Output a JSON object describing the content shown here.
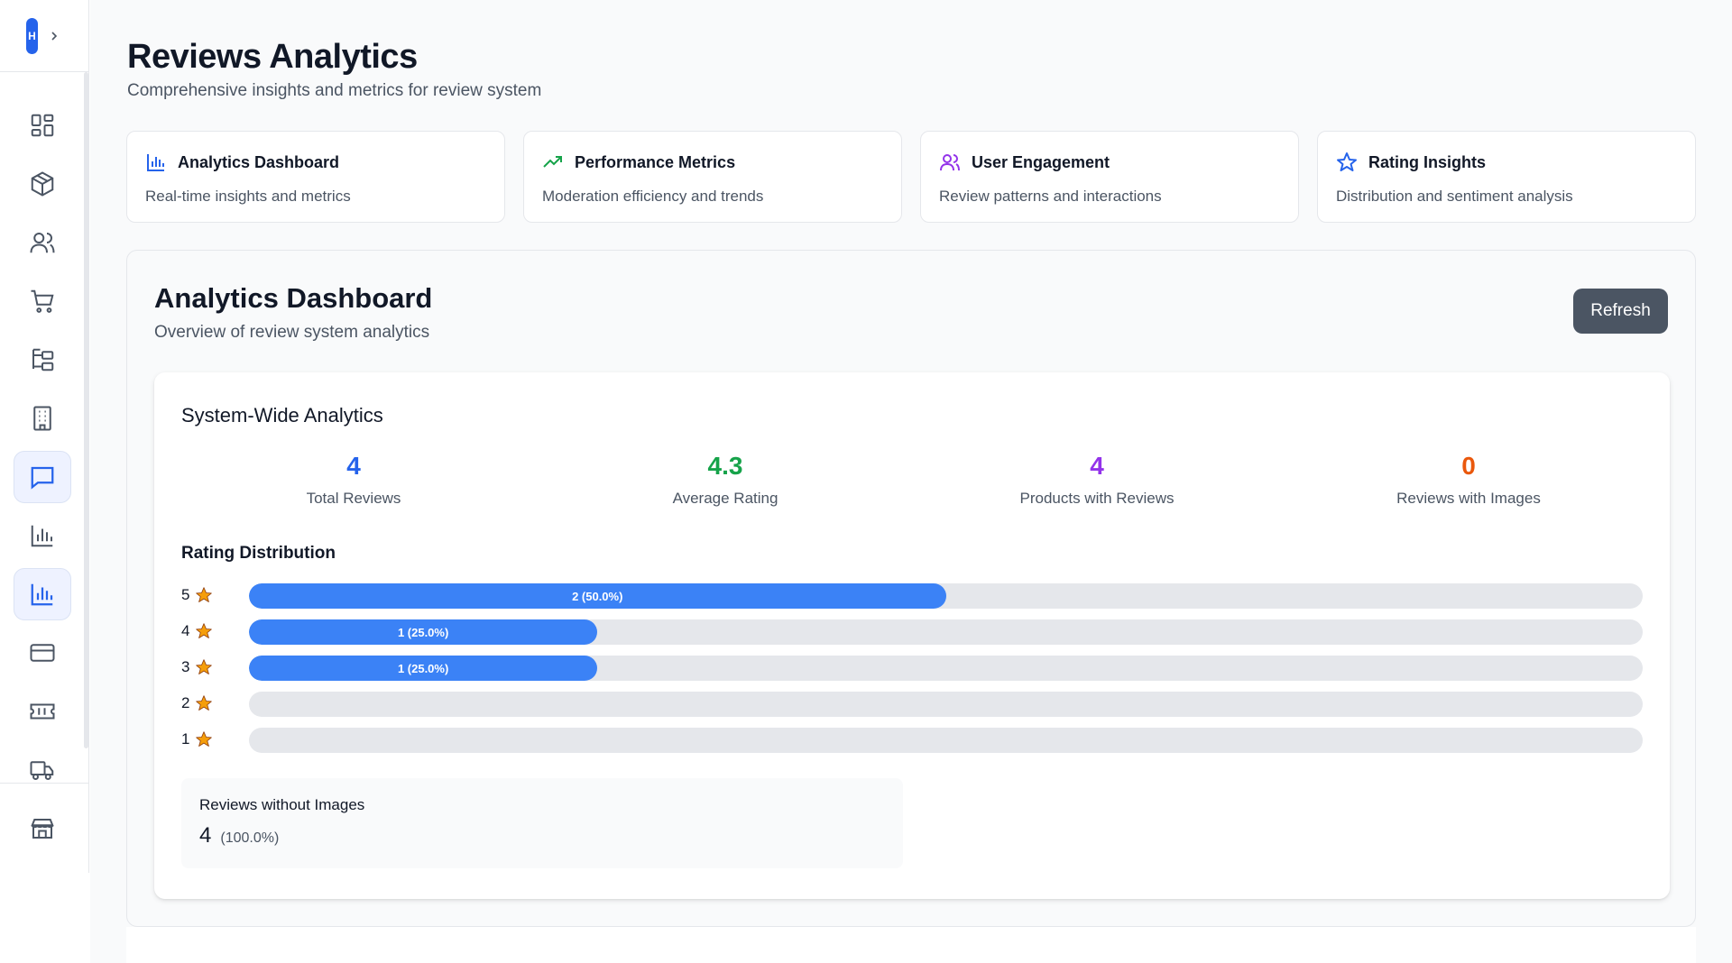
{
  "sidebar": {
    "brand_initial": "H",
    "items": [
      {
        "icon": "dashboard-icon"
      },
      {
        "icon": "box-icon"
      },
      {
        "icon": "users-icon"
      },
      {
        "icon": "cart-icon"
      },
      {
        "icon": "category-tree-icon"
      },
      {
        "icon": "building-icon"
      },
      {
        "icon": "message-icon",
        "active": true
      },
      {
        "icon": "bar-chart-icon"
      },
      {
        "icon": "bar-chart-icon",
        "active": true
      },
      {
        "icon": "credit-card-icon"
      },
      {
        "icon": "ticket-icon"
      },
      {
        "icon": "truck-icon"
      },
      {
        "icon": "store-icon"
      }
    ]
  },
  "header": {
    "title": "Reviews Analytics",
    "subtitle": "Comprehensive insights and metrics for review system"
  },
  "feature_cards": [
    {
      "icon": "bar-chart-icon",
      "icon_color": "#2563eb",
      "title": "Analytics Dashboard",
      "description": "Real-time insights and metrics"
    },
    {
      "icon": "trending-up-icon",
      "icon_color": "#16a34a",
      "title": "Performance Metrics",
      "description": "Moderation efficiency and trends"
    },
    {
      "icon": "users-icon",
      "icon_color": "#9333ea",
      "title": "User Engagement",
      "description": "Review patterns and interactions"
    },
    {
      "icon": "star-icon",
      "icon_color": "#2563eb",
      "title": "Rating Insights",
      "description": "Distribution and sentiment analysis"
    }
  ],
  "dashboard": {
    "title": "Analytics Dashboard",
    "subtitle": "Overview of review system analytics",
    "refresh_label": "Refresh",
    "section_title": "System-Wide Analytics",
    "stats": [
      {
        "value": "4",
        "label": "Total Reviews",
        "color": "#2563eb"
      },
      {
        "value": "4.3",
        "label": "Average Rating",
        "color": "#16a34a"
      },
      {
        "value": "4",
        "label": "Products with Reviews",
        "color": "#9333ea"
      },
      {
        "value": "0",
        "label": "Reviews with Images",
        "color": "#ea580c"
      }
    ],
    "distribution_title": "Rating Distribution",
    "distribution": [
      {
        "stars": "5",
        "fraction": 0.5,
        "text": "2 (50.0%)"
      },
      {
        "stars": "4",
        "fraction": 0.25,
        "text": "1 (25.0%)"
      },
      {
        "stars": "3",
        "fraction": 0.25,
        "text": "1 (25.0%)"
      },
      {
        "stars": "2",
        "fraction": 0,
        "text": ""
      },
      {
        "stars": "1",
        "fraction": 0,
        "text": ""
      }
    ],
    "no_images": {
      "label": "Reviews without Images",
      "count": "4",
      "percent": "(100.0%)"
    }
  },
  "colors": {
    "accent": "#2563eb",
    "bar_fill": "#3b82f6",
    "star": "#f59e0b"
  }
}
